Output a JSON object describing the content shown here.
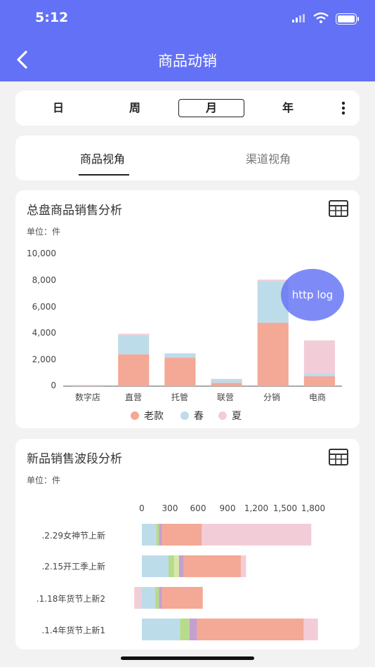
{
  "status": {
    "time": "5:12"
  },
  "nav": {
    "title": "商品动销"
  },
  "period": {
    "options": [
      "日",
      "周",
      "月",
      "年"
    ],
    "selected": "月"
  },
  "view_tabs": {
    "active": "商品视角",
    "inactive": "渠道视角"
  },
  "debug_bubble": "http log",
  "colors": {
    "brand": "#6271f5",
    "old": "#f4a896",
    "spring": "#bddcea",
    "summer": "#f2cdd8",
    "green": "#b6db8c",
    "purple": "#c3a0d0"
  },
  "chart_data": [
    {
      "type": "bar",
      "title": "总盘商品销售分析",
      "unit_label": "单位：件",
      "categories": [
        "数字店",
        "直营",
        "托管",
        "联营",
        "分销",
        "电商"
      ],
      "ylim": [
        0,
        10000
      ],
      "yticks": [
        "10,000",
        "8,000",
        "6,000",
        "4,000",
        "2,000",
        "0"
      ],
      "series": [
        {
          "name": "老款",
          "values": [
            0,
            2400,
            2150,
            250,
            4780,
            750
          ]
        },
        {
          "name": "春",
          "values": [
            0,
            1450,
            300,
            280,
            3150,
            200
          ]
        },
        {
          "name": "夏",
          "values": [
            0,
            100,
            30,
            20,
            100,
            2500
          ]
        }
      ],
      "legend_position": "bottom"
    },
    {
      "type": "bar",
      "orientation": "horizontal",
      "title": "新品销售波段分析",
      "unit_label": "单位：件",
      "xticks": [
        "0",
        "300",
        "600",
        "900",
        "1,200",
        "1,500",
        "1,800"
      ],
      "xlim": [
        0,
        1800
      ],
      "categories": [
        ".2.29女神节上新",
        ".2.15开工季上新",
        ".1.18年货节上新2",
        ".1.4年货节上新1"
      ],
      "segments": [
        [
          {
            "c": "spring",
            "v": 150
          },
          {
            "c": "green",
            "v": 30
          },
          {
            "c": "purple",
            "v": 30
          },
          {
            "c": "old",
            "v": 420
          },
          {
            "c": "summer",
            "v": 1150
          }
        ],
        [
          {
            "c": "spring",
            "v": 280
          },
          {
            "c": "green",
            "v": 60
          },
          {
            "c": "green2",
            "v": 50
          },
          {
            "c": "purple",
            "v": 50
          },
          {
            "c": "old",
            "v": 600
          },
          {
            "c": "summer",
            "v": 55
          }
        ],
        [
          {
            "c": "summer",
            "v": -80
          },
          {
            "c": "spring",
            "v": 140
          },
          {
            "c": "green",
            "v": 40
          },
          {
            "c": "purple",
            "v": 30
          },
          {
            "c": "old",
            "v": 430
          }
        ],
        [
          {
            "c": "spring",
            "v": 400
          },
          {
            "c": "green",
            "v": 100
          },
          {
            "c": "purple",
            "v": 80
          },
          {
            "c": "old",
            "v": 1120
          },
          {
            "c": "summer",
            "v": 150
          }
        ]
      ]
    }
  ]
}
